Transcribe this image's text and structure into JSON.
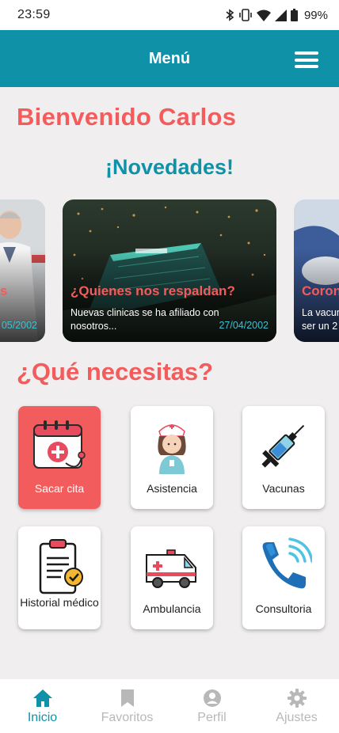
{
  "status": {
    "time": "23:59",
    "battery": "99%"
  },
  "topbar": {
    "title": "Menú"
  },
  "welcome": "Bienvenido Carlos",
  "news": {
    "heading": "¡Novedades!",
    "cards": [
      {
        "title": "s",
        "desc": "",
        "date": "05/2002"
      },
      {
        "title": "¿Quienes nos respaldan?",
        "desc": "Nuevas clinicas se ha afiliado con nosotros...",
        "date": "27/04/2002"
      },
      {
        "title": "Coron",
        "desc": "La vacun ser un 2",
        "date": ""
      }
    ]
  },
  "needs": {
    "heading": "¿Qué necesitas?",
    "items": [
      {
        "label": "Sacar cita",
        "icon": "calendar-appointment-icon"
      },
      {
        "label": "Asistencia",
        "icon": "nurse-icon"
      },
      {
        "label": "Vacunas",
        "icon": "syringe-icon"
      },
      {
        "label": "Historial médico",
        "icon": "clipboard-icon"
      },
      {
        "label": "Ambulancia",
        "icon": "ambulance-icon"
      },
      {
        "label": "Consultoria",
        "icon": "phone-icon"
      }
    ]
  },
  "nav": [
    {
      "label": "Inicio",
      "icon": "home-icon"
    },
    {
      "label": "Favoritos",
      "icon": "bookmark-icon"
    },
    {
      "label": "Perfil",
      "icon": "profile-icon"
    },
    {
      "label": "Ajustes",
      "icon": "gear-icon"
    }
  ],
  "colors": {
    "primary": "#0f92a8",
    "accent": "#f25c5c",
    "background": "#f0eeee",
    "date": "#3fc0d2"
  }
}
